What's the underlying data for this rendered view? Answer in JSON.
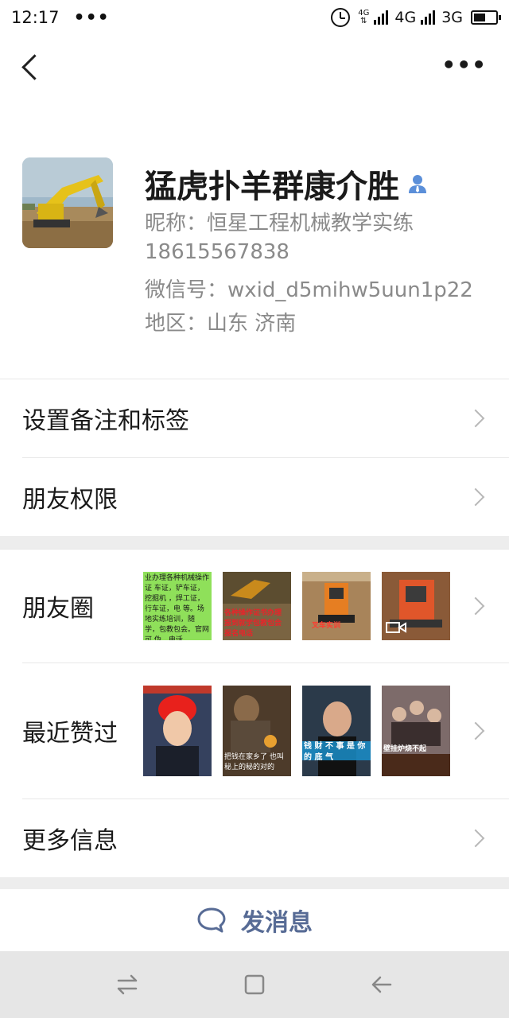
{
  "status_bar": {
    "time": "12:17",
    "dots": "•••",
    "net_small_top": "4G",
    "net_4g": "4G",
    "net_3g": "3G",
    "battery_level": 0.55
  },
  "nav": {
    "more": "•••"
  },
  "profile": {
    "name": "猛虎扑羊群康介胜",
    "nickname": "昵称：恒星工程机械教学实练",
    "phone": "18615567838",
    "wechat_id": "微信号：wxid_d5mihw5uun1p22",
    "region": "地区：山东  济南"
  },
  "rows": {
    "remark": "设置备注和标签",
    "permissions": "朋友权限",
    "moments": "朋友圈",
    "recent_likes": "最近赞过",
    "more_info": "更多信息"
  },
  "moments_thumbs": [
    {
      "text": "业办理各种机械操作证 车证，铲车证，挖掘机 ，焊工证，行车证，电 等。场地实练培训，随 学，包教包会。官网可 伪，电话 18615567838"
    },
    {
      "text": "各种操作证书办理 报到就学包教包会 报名电话"
    },
    {
      "text": "叉车实训"
    },
    {
      "text": ""
    }
  ],
  "likes_thumbs": [
    {
      "text": ""
    },
    {
      "text": "把钱在家乡了 也叫秘上的秘的对的"
    },
    {
      "text": "钱 财 不 事 是 你 的 底 气"
    },
    {
      "text": "壁挂炉烧不起"
    }
  ],
  "send_message": "发消息",
  "colors": {
    "link": "#576b95",
    "gender_icon": "#5b8fd9",
    "divider": "#e8e8e8",
    "section_gap": "#ededed"
  }
}
